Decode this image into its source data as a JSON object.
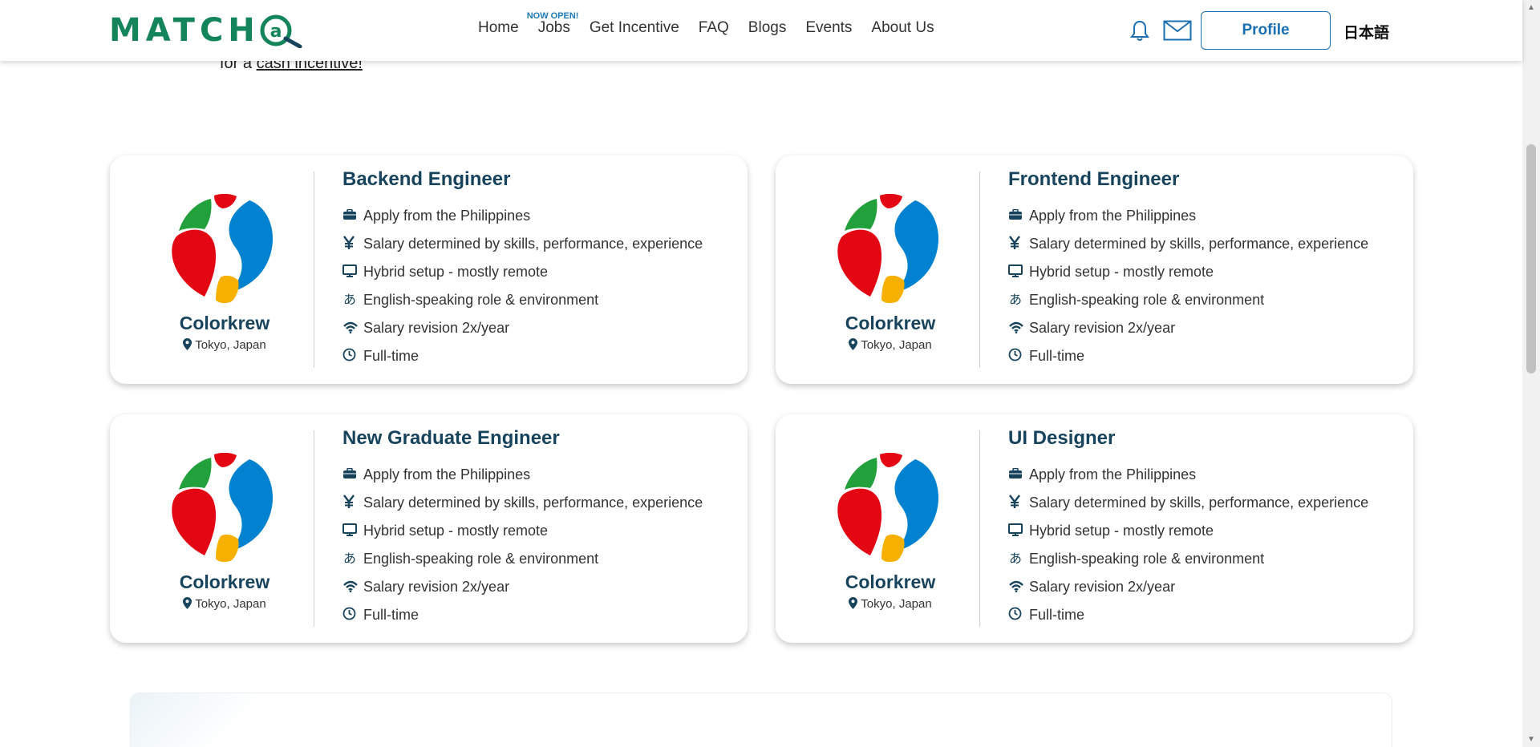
{
  "intro": {
    "prefix": "for a ",
    "link": "cash incentive!"
  },
  "header": {
    "logo_text": "MATCH",
    "nav": [
      {
        "label": "Home"
      },
      {
        "label": "Jobs",
        "badge": "NOW OPEN!"
      },
      {
        "label": "Get Incentive"
      },
      {
        "label": "FAQ"
      },
      {
        "label": "Blogs"
      },
      {
        "label": "Events"
      },
      {
        "label": "About Us"
      }
    ],
    "profile_label": "Profile",
    "language_label": "日本語"
  },
  "jobs": [
    {
      "title": "Backend Engineer",
      "company": "Colorkrew",
      "location": "Tokyo, Japan",
      "features": [
        {
          "icon": "briefcase-icon",
          "text": "Apply from the Philippines"
        },
        {
          "icon": "yen-icon",
          "text": "Salary determined by skills, performance, experience"
        },
        {
          "icon": "monitor-icon",
          "text": "Hybrid setup - mostly remote"
        },
        {
          "icon": "language-icon",
          "text": "English-speaking role & environment"
        },
        {
          "icon": "signal-icon",
          "text": "Salary revision 2x/year"
        },
        {
          "icon": "clock-icon",
          "text": "Full-time"
        }
      ]
    },
    {
      "title": "Frontend Engineer",
      "company": "Colorkrew",
      "location": "Tokyo, Japan",
      "features": [
        {
          "icon": "briefcase-icon",
          "text": "Apply from the Philippines"
        },
        {
          "icon": "yen-icon",
          "text": "Salary determined by skills, performance, experience"
        },
        {
          "icon": "monitor-icon",
          "text": "Hybrid setup - mostly remote"
        },
        {
          "icon": "language-icon",
          "text": "English-speaking role & environment"
        },
        {
          "icon": "signal-icon",
          "text": "Salary revision 2x/year"
        },
        {
          "icon": "clock-icon",
          "text": "Full-time"
        }
      ]
    },
    {
      "title": "New Graduate Engineer",
      "company": "Colorkrew",
      "location": "Tokyo, Japan",
      "features": [
        {
          "icon": "briefcase-icon",
          "text": "Apply from the Philippines"
        },
        {
          "icon": "yen-icon",
          "text": "Salary determined by skills, performance, experience"
        },
        {
          "icon": "monitor-icon",
          "text": "Hybrid setup - mostly remote"
        },
        {
          "icon": "language-icon",
          "text": "English-speaking role & environment"
        },
        {
          "icon": "signal-icon",
          "text": "Salary revision 2x/year"
        },
        {
          "icon": "clock-icon",
          "text": "Full-time"
        }
      ]
    },
    {
      "title": "UI Designer",
      "company": "Colorkrew",
      "location": "Tokyo, Japan",
      "features": [
        {
          "icon": "briefcase-icon",
          "text": "Apply from the Philippines"
        },
        {
          "icon": "yen-icon",
          "text": "Salary determined by skills, performance, experience"
        },
        {
          "icon": "monitor-icon",
          "text": "Hybrid setup - mostly remote"
        },
        {
          "icon": "language-icon",
          "text": "English-speaking role & environment"
        },
        {
          "icon": "signal-icon",
          "text": "Salary revision 2x/year"
        },
        {
          "icon": "clock-icon",
          "text": "Full-time"
        }
      ]
    }
  ],
  "colors": {
    "brand_green": "#14855a",
    "title_navy": "#17435c",
    "profile_blue": "#1a6fb3",
    "logo_red": "#e30613",
    "logo_blue": "#0082d0",
    "logo_green": "#22a03c",
    "logo_yellow": "#f6b100"
  }
}
